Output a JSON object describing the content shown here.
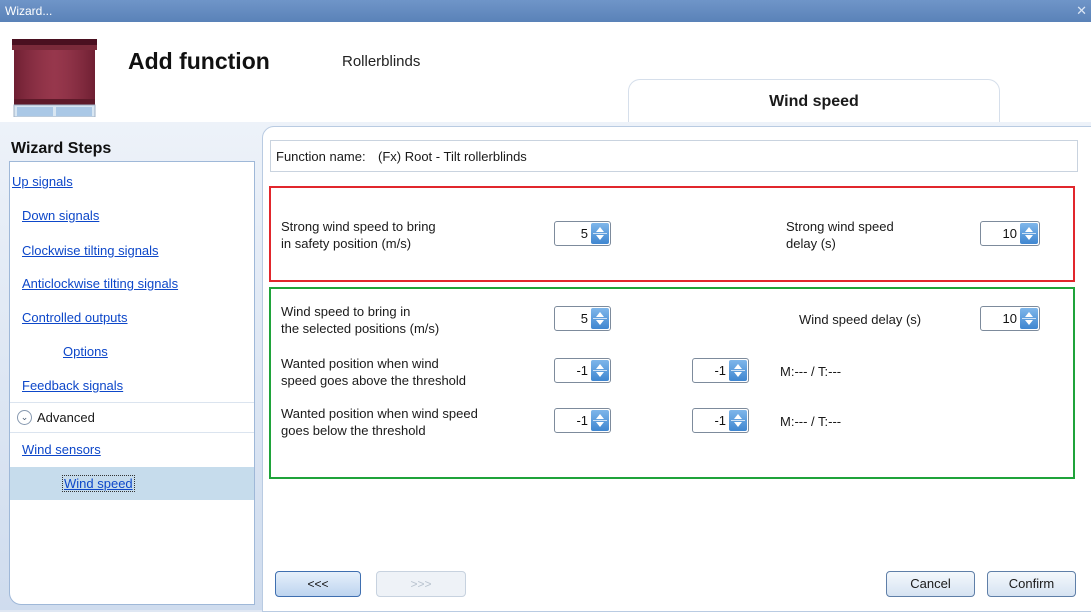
{
  "window": {
    "title": "Wizard...",
    "close_glyph": "✕"
  },
  "header": {
    "title": "Add function",
    "subtitle": "Rollerblinds",
    "icon": "rollerblind-icon",
    "tab_label": "Wind speed"
  },
  "sidebar": {
    "title": "Wizard Steps",
    "items": [
      {
        "label": "Up signals"
      },
      {
        "label": "Down signals"
      },
      {
        "label": "Clockwise tilting signals"
      },
      {
        "label": "Anticlockwise tilting signals"
      },
      {
        "label": "Controlled outputs"
      },
      {
        "label": "Options"
      },
      {
        "label": "Feedback signals"
      }
    ],
    "advanced_label": "Advanced",
    "advanced_items": [
      {
        "label": "Wind sensors"
      },
      {
        "label": "Wind speed"
      }
    ]
  },
  "form": {
    "function_name_label": "Function name:",
    "function_name_value": "(Fx) Root - Tilt rollerblinds",
    "strong": {
      "speed_label_1": "Strong wind speed to bring",
      "speed_label_2": "in safety position (m/s)",
      "speed_value": "5",
      "delay_label_1": "Strong wind speed",
      "delay_label_2": "delay (s)",
      "delay_value": "10"
    },
    "normal": {
      "speed_label_1": "Wind speed to bring in",
      "speed_label_2": "the selected positions (m/s)",
      "speed_value": "5",
      "delay_label": "Wind speed delay (s)",
      "delay_value": "10",
      "above_label_1": "Wanted position when wind",
      "above_label_2": "speed goes above the threshold",
      "above_value_1": "-1",
      "above_value_2": "-1",
      "above_status": "M:--- / T:---",
      "below_label_1": "Wanted position when  wind speed",
      "below_label_2": "goes below the threshold",
      "below_value_1": "-1",
      "below_value_2": "-1",
      "below_status": "M:--- / T:---"
    }
  },
  "footer": {
    "back_label": "<<<",
    "next_label": ">>>",
    "cancel_label": "Cancel",
    "confirm_label": "Confirm"
  },
  "colors": {
    "safety_box_border": "#e1262c",
    "selected_box_border": "#1fa33a",
    "link": "#0d47c9",
    "selected_step_bg": "#c6dcec"
  }
}
